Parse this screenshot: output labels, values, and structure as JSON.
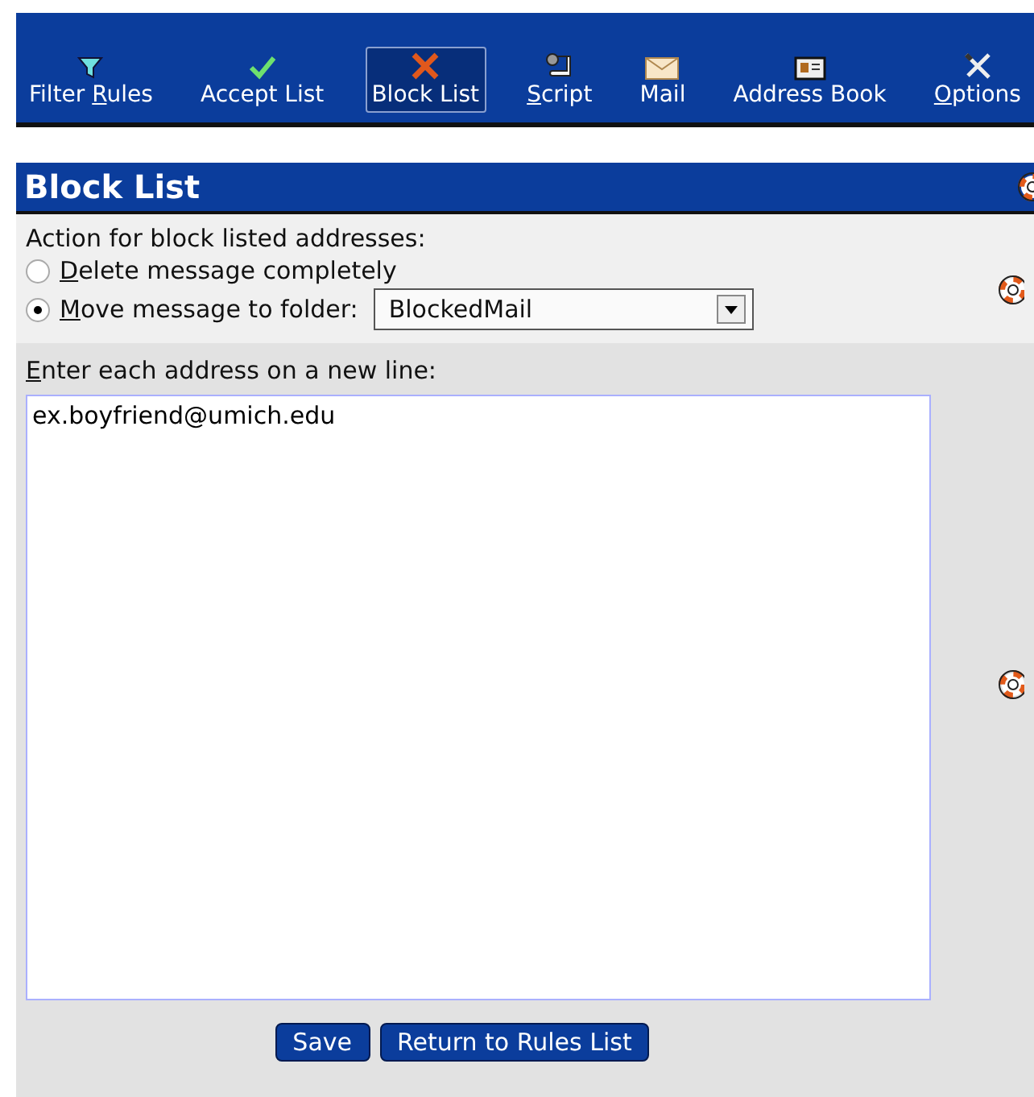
{
  "toolbar": [
    {
      "kind": "filter",
      "pre": "Filter ",
      "key": "R",
      "post": "ules",
      "selected": false
    },
    {
      "kind": "check",
      "post": "Accept List",
      "selected": false
    },
    {
      "kind": "cross",
      "post": "Block List",
      "selected": true
    },
    {
      "kind": "script",
      "key": "S",
      "post": "cript",
      "selected": false
    },
    {
      "kind": "mail",
      "post": "Mail",
      "selected": false
    },
    {
      "kind": "card",
      "post": "Address Book",
      "selected": false
    },
    {
      "kind": "tools",
      "key": "O",
      "post": "ptions",
      "selected": false
    }
  ],
  "header": {
    "title": "Block List"
  },
  "action": {
    "label": "Action for block listed addresses:",
    "options": [
      {
        "key": "D",
        "post": "elete message completely",
        "selected": false
      },
      {
        "key": "M",
        "post": "ove message to folder:",
        "selected": true
      }
    ],
    "folder": "BlockedMail"
  },
  "addresses": {
    "key": "E",
    "post": "nter each address on a new line:",
    "value": "ex.boyfriend@umich.edu"
  },
  "buttons": [
    "Save",
    "Return to Rules List"
  ]
}
